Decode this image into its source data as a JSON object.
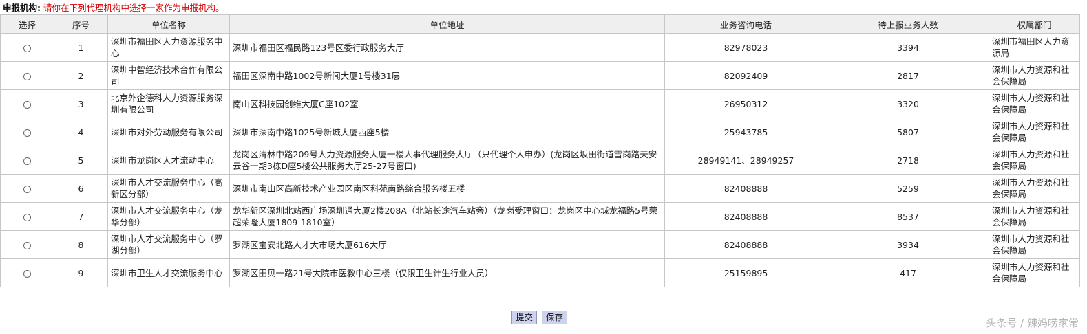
{
  "header": {
    "label": "申报机构:",
    "instruction": "请你在下列代理机构中选择一家作为申报机构。"
  },
  "columns": [
    "选择",
    "序号",
    "单位名称",
    "单位地址",
    "业务咨询电话",
    "待上报业务人数",
    "权属部门"
  ],
  "rows": [
    {
      "no": "1",
      "name": "深圳市福田区人力资源服务中心",
      "address": "深圳市福田区福民路123号区委行政服务大厅",
      "phone": "82978023",
      "count": "3394",
      "dept": "深圳市福田区人力资源局"
    },
    {
      "no": "2",
      "name": "深圳中智经济技术合作有限公司",
      "address": "福田区深南中路1002号新闻大厦1号楼31层",
      "phone": "82092409",
      "count": "2817",
      "dept": "深圳市人力资源和社会保障局"
    },
    {
      "no": "3",
      "name": "北京外企德科人力资源服务深圳有限公司",
      "address": "南山区科技园创维大厦C座102室",
      "phone": "26950312",
      "count": "3320",
      "dept": "深圳市人力资源和社会保障局"
    },
    {
      "no": "4",
      "name": "深圳市对外劳动服务有限公司",
      "address": "深圳市深南中路1025号新城大厦西座5楼",
      "phone": "25943785",
      "count": "5807",
      "dept": "深圳市人力资源和社会保障局"
    },
    {
      "no": "5",
      "name": "深圳市龙岗区人才流动中心",
      "address": "龙岗区清林中路209号人力资源服务大厦一楼人事代理服务大厅（只代理个人申办）(龙岗区坂田街道雪岗路天安云谷一期3栋D座5楼公共服务大厅25-27号窗口)",
      "phone": "28949141、28949257",
      "count": "2718",
      "dept": "深圳市人力资源和社会保障局"
    },
    {
      "no": "6",
      "name": "深圳市人才交流服务中心（高新区分部）",
      "address": "深圳市南山区高新技术产业园区南区科苑南路综合服务楼五楼",
      "phone": "82408888",
      "count": "5259",
      "dept": "深圳市人力资源和社会保障局"
    },
    {
      "no": "7",
      "name": "深圳市人才交流服务中心（龙华分部）",
      "address": "龙华新区深圳北站西广场深圳通大厦2楼208A（北站长途汽车站旁）（龙岗受理窗口：龙岗区中心城龙福路5号荣超荣隆大厦1809-1810室）",
      "phone": "82408888",
      "count": "8537",
      "dept": "深圳市人力资源和社会保障局"
    },
    {
      "no": "8",
      "name": "深圳市人才交流服务中心（罗湖分部）",
      "address": "罗湖区宝安北路人才大市场大厦616大厅",
      "phone": "82408888",
      "count": "3934",
      "dept": "深圳市人力资源和社会保障局"
    },
    {
      "no": "9",
      "name": "深圳市卫生人才交流服务中心",
      "address": "罗湖区田贝一路21号大院市医教中心三楼（仅限卫生计生行业人员）",
      "phone": "25159895",
      "count": "417",
      "dept": "深圳市人力资源和社会保障局"
    }
  ],
  "buttons": {
    "submit": "提交",
    "save": "保存"
  },
  "watermark": "头条号 / 辣妈唠家常"
}
